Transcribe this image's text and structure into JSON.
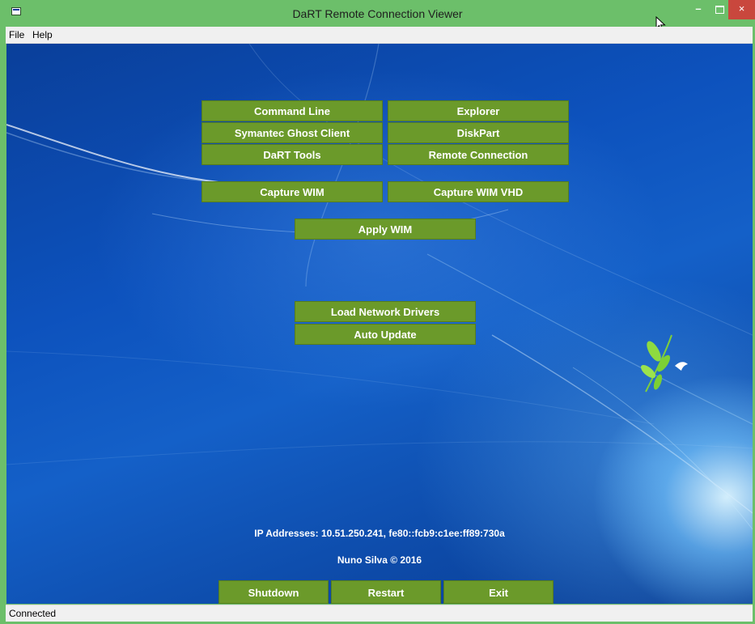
{
  "window": {
    "title": "DaRT Remote Connection Viewer",
    "minimize_glyph": "–",
    "close_glyph": "×"
  },
  "menu": {
    "items": [
      "File",
      "Help"
    ]
  },
  "tools": {
    "command_line": "Command Line",
    "explorer": "Explorer",
    "ghost_client": "Symantec Ghost Client",
    "diskpart": "DiskPart",
    "dart_tools": "DaRT Tools",
    "remote_connection": "Remote Connection",
    "capture_wim": "Capture WIM",
    "capture_wim_vhd": "Capture WIM VHD",
    "apply_wim": "Apply WIM",
    "load_network_drivers": "Load Network Drivers",
    "auto_update": "Auto Update"
  },
  "info": {
    "ip_addresses": "IP Addresses: 10.51.250.241, fe80::fcb9:c1ee:ff89:730a",
    "credit": "Nuno Silva © 2016"
  },
  "actions": {
    "shutdown": "Shutdown",
    "restart": "Restart",
    "exit": "Exit"
  },
  "status": {
    "text": "Connected"
  },
  "colors": {
    "titlebar": "#6cbf6a",
    "button": "#6b9a2a",
    "close": "#c9473d"
  }
}
